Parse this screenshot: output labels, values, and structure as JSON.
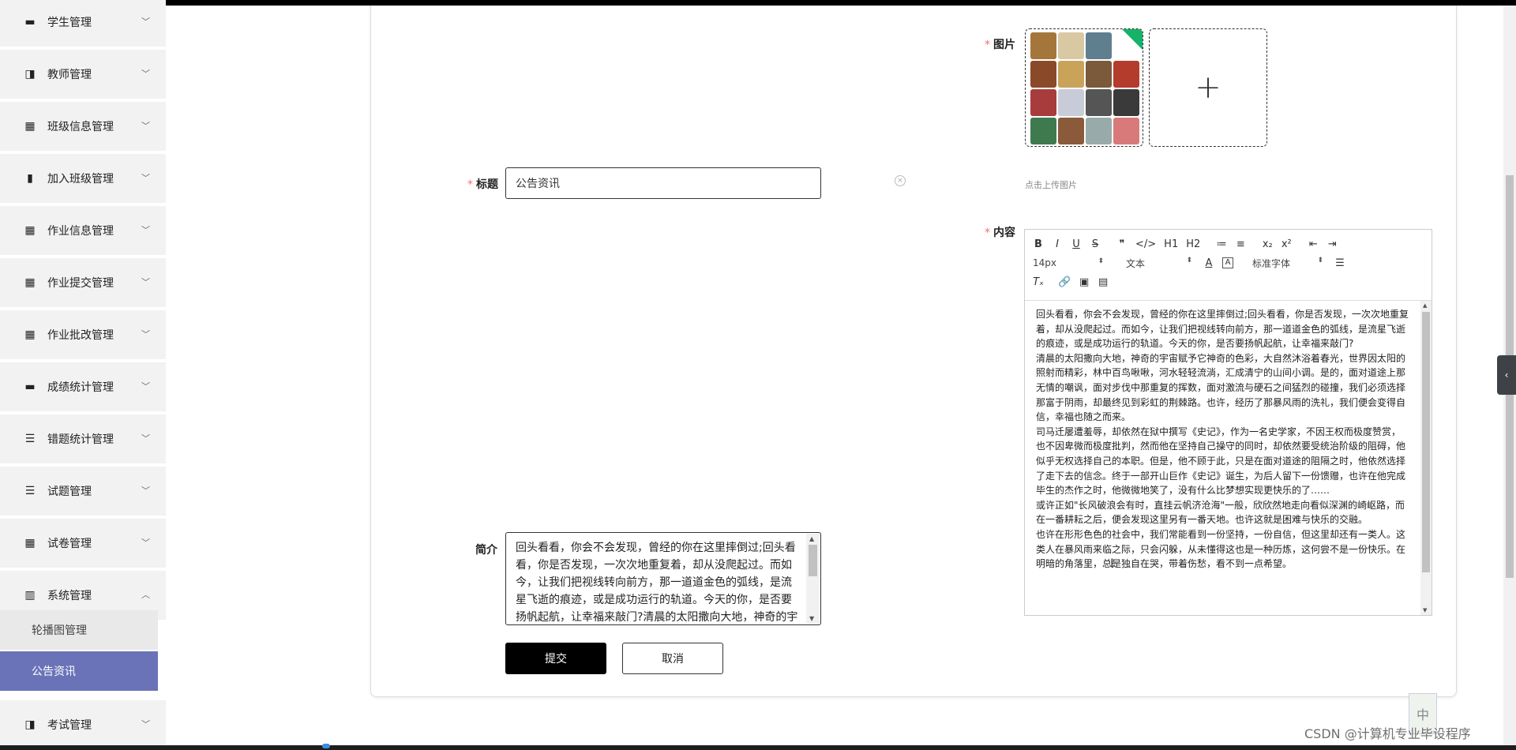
{
  "sidebar": {
    "items": [
      {
        "label": "学生管理",
        "icon": "monitor-icon",
        "glyph": "▬"
      },
      {
        "label": "教师管理",
        "icon": "briefcase-icon",
        "glyph": "◨"
      },
      {
        "label": "班级信息管理",
        "icon": "grid-icon",
        "glyph": "▦"
      },
      {
        "label": "加入班级管理",
        "icon": "clipboard-icon",
        "glyph": "▮"
      },
      {
        "label": "作业信息管理",
        "icon": "grid-icon",
        "glyph": "▦"
      },
      {
        "label": "作业提交管理",
        "icon": "grid-icon",
        "glyph": "▦"
      },
      {
        "label": "作业批改管理",
        "icon": "grid-icon",
        "glyph": "▦"
      },
      {
        "label": "成绩统计管理",
        "icon": "message-icon",
        "glyph": "▬"
      },
      {
        "label": "错题统计管理",
        "icon": "list-icon",
        "glyph": "☰"
      },
      {
        "label": "试题管理",
        "icon": "list-icon",
        "glyph": "☰"
      },
      {
        "label": "试卷管理",
        "icon": "grid-small-icon",
        "glyph": "▦"
      },
      {
        "label": "系统管理",
        "icon": "bar-chart-icon",
        "glyph": "▥"
      }
    ],
    "sub_items": [
      {
        "label": "轮播图管理"
      },
      {
        "label": "公告资讯"
      }
    ],
    "last_item": {
      "label": "考试管理",
      "icon": "briefcase-icon",
      "glyph": "◨"
    }
  },
  "form": {
    "title_label": "标题",
    "title_value": "公告资讯",
    "image_label": "图片",
    "upload_plus": "+",
    "upload_tip": "点击上传图片",
    "intro_label": "简介",
    "intro_value": "回头看看，你会不会发现，曾经的你在这里摔倒过;回头看看，你是否发现，一次次地重复着，却从没爬起过。而如今，让我们把视线转向前方，那一道道金色的弧线，是流星飞逝的痕迹，或是成功运行的轨道。今天的你，是否要扬帆起航，让幸福来敲门?清晨的太阳撒向大地，神奇的宇",
    "content_label": "内容",
    "submit": "提交",
    "cancel": "取消"
  },
  "editor": {
    "toolbar_row1": [
      "B",
      "I",
      "U",
      "S",
      "❞",
      "</>",
      "H1",
      "H2",
      "≔",
      "≡",
      "x₂",
      "x²",
      "⇤",
      "⇥"
    ],
    "font_size": "14px",
    "text_type": "文本",
    "font_family": "标准字体",
    "content": [
      "回头看看，你会不会发现，曾经的你在这里摔倒过;回头看看，你是否发现，一次次地重复着，却从没爬起过。而如今，让我们把视线转向前方，那一道道金色的弧线，是流星飞逝的痕迹，或是成功运行的轨道。今天的你，是否要扬帆起航，让幸福来敲门?",
      "清晨的太阳撒向大地，神奇的宇宙赋予它神奇的色彩，大自然沐浴着春光，世界因太阳的照射而精彩，林中百鸟啾啾，河水轻轻流淌，汇成清宁的山间小调。是的，面对道途上那无情的嘲讽，面对步伐中那重复的挥数，面对激流与硬石之间猛烈的碰撞，我们必须选择那富于阴雨，却最终见到彩虹的荆棘路。也许，经历了那暴风雨的洗礼，我们便会变得自信，幸福也随之而来。",
      "司马迁屡遭羞辱，却依然在狱中撰写《史记》，作为一名史学家，不因王权而极度赞赏，也不因卑微而极度批判，然而他在坚持自己操守的同时，却依然要受统治阶级的阻碍，他似乎无权选择自己的本职。但是，他不顾于此，只是在面对道途的阻隔之时，他依然选择了走下去的信念。终于一部开山巨作《史记》诞生，为后人留下一份馈赠，也许在他完成毕生的杰作之时，他微微地笑了，没有什么比梦想实现更快乐的了……",
      "或许正如\"长风破浪会有时，直挂云帆济沧海\"一般，欣欣然地走向看似深渊的崎岖路，而在一番耕耘之后，便会发现这里另有一番天地。也许这就是困难与快乐的交融。",
      "也许在形形色色的社会中，我们常能看到一份坚持，一份自信，但这里却还有一类人。这类人在暴风雨来临之际，只会闪躲，从未懂得这也是一种历炼，这何尝不是一份快乐。在明暗的角落里，总是独自在哭，带着伤愁，看不到一点希望。"
    ]
  },
  "overlay": {
    "ime_char": "中",
    "watermark": "CSDN @计算机专业毕设程序"
  },
  "colors": {
    "active_menu": "#6a73b8",
    "required": "#f56c6c",
    "upload_corner": "#17b26a"
  }
}
